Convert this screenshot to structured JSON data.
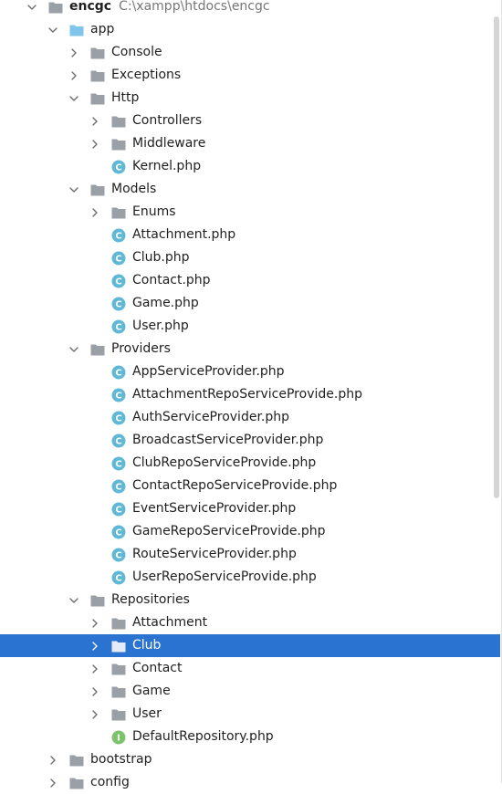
{
  "tree": [
    {
      "label": "encgc",
      "path": "C:\\xampp\\htdocs\\encgc",
      "level": 0,
      "type": "folder",
      "state": "open",
      "root": true
    },
    {
      "label": "app",
      "level": 1,
      "type": "folder",
      "state": "open",
      "module": true
    },
    {
      "label": "Console",
      "level": 2,
      "type": "folder",
      "state": "closed"
    },
    {
      "label": "Exceptions",
      "level": 2,
      "type": "folder",
      "state": "closed"
    },
    {
      "label": "Http",
      "level": 2,
      "type": "folder",
      "state": "open"
    },
    {
      "label": "Controllers",
      "level": 3,
      "type": "folder",
      "state": "closed"
    },
    {
      "label": "Middleware",
      "level": 3,
      "type": "folder",
      "state": "closed"
    },
    {
      "label": "Kernel.php",
      "level": 3,
      "type": "class"
    },
    {
      "label": "Models",
      "level": 2,
      "type": "folder",
      "state": "open"
    },
    {
      "label": "Enums",
      "level": 3,
      "type": "folder",
      "state": "closed"
    },
    {
      "label": "Attachment.php",
      "level": 3,
      "type": "class"
    },
    {
      "label": "Club.php",
      "level": 3,
      "type": "class"
    },
    {
      "label": "Contact.php",
      "level": 3,
      "type": "class"
    },
    {
      "label": "Game.php",
      "level": 3,
      "type": "class"
    },
    {
      "label": "User.php",
      "level": 3,
      "type": "class"
    },
    {
      "label": "Providers",
      "level": 2,
      "type": "folder",
      "state": "open"
    },
    {
      "label": "AppServiceProvider.php",
      "level": 3,
      "type": "class"
    },
    {
      "label": "AttachmentRepoServiceProvide.php",
      "level": 3,
      "type": "class"
    },
    {
      "label": "AuthServiceProvider.php",
      "level": 3,
      "type": "class"
    },
    {
      "label": "BroadcastServiceProvider.php",
      "level": 3,
      "type": "class"
    },
    {
      "label": "ClubRepoServiceProvide.php",
      "level": 3,
      "type": "class"
    },
    {
      "label": "ContactRepoServiceProvide.php",
      "level": 3,
      "type": "class"
    },
    {
      "label": "EventServiceProvider.php",
      "level": 3,
      "type": "class"
    },
    {
      "label": "GameRepoServiceProvide.php",
      "level": 3,
      "type": "class"
    },
    {
      "label": "RouteServiceProvider.php",
      "level": 3,
      "type": "class"
    },
    {
      "label": "UserRepoServiceProvide.php",
      "level": 3,
      "type": "class"
    },
    {
      "label": "Repositories",
      "level": 2,
      "type": "folder",
      "state": "open"
    },
    {
      "label": "Attachment",
      "level": 3,
      "type": "folder",
      "state": "closed"
    },
    {
      "label": "Club",
      "level": 3,
      "type": "folder",
      "state": "closed",
      "selected": true
    },
    {
      "label": "Contact",
      "level": 3,
      "type": "folder",
      "state": "closed"
    },
    {
      "label": "Game",
      "level": 3,
      "type": "folder",
      "state": "closed"
    },
    {
      "label": "User",
      "level": 3,
      "type": "folder",
      "state": "closed"
    },
    {
      "label": "DefaultRepository.php",
      "level": 3,
      "type": "interface"
    },
    {
      "label": "bootstrap",
      "level": 1,
      "type": "folder",
      "state": "closed"
    },
    {
      "label": "config",
      "level": 1,
      "type": "folder",
      "state": "closed"
    }
  ],
  "colors": {
    "selection": "#2b73d0",
    "folder": "#9aa0a6",
    "module_folder": "#7fc4ea",
    "class_icon": "#5fb8d6",
    "interface_icon": "#7cc36b",
    "path_text": "#767676"
  }
}
